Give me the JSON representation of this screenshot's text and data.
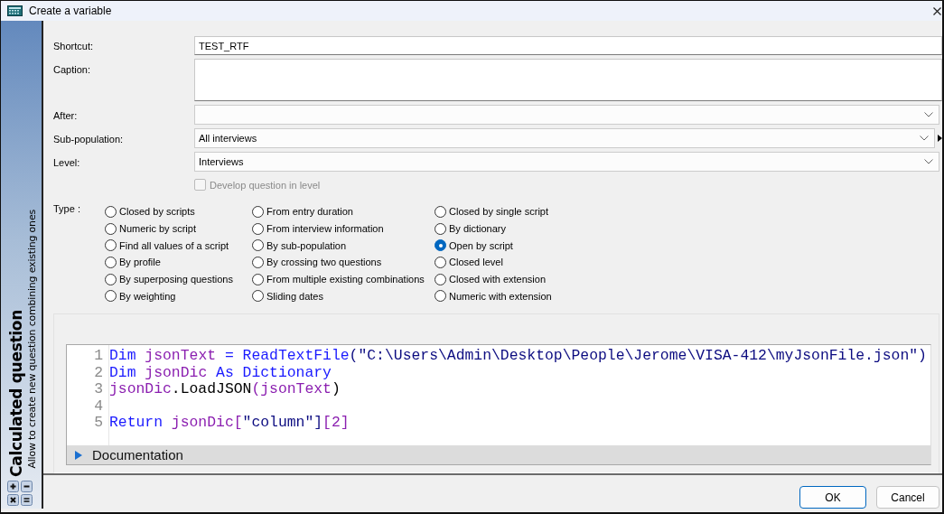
{
  "window": {
    "title": "Create a variable"
  },
  "sidebar": {
    "title": "Calculated question",
    "subtitle": "Allow to create new question combining existing ones"
  },
  "fields": [
    {
      "kind": "text",
      "label": "Shortcut:",
      "value": "TEST_RTF"
    },
    {
      "kind": "textarea",
      "label": "Caption:"
    },
    {
      "kind": "dropdown",
      "label": "After:",
      "side_arrow": false
    },
    {
      "kind": "dropdown",
      "label": "Sub-population:",
      "value": "All interviews",
      "side_arrow": true
    },
    {
      "kind": "dropdown",
      "label": "Level:",
      "value": "Interviews",
      "side_arrow": false
    }
  ],
  "develop_checkbox": {
    "label": "Develop question in level",
    "checked": false,
    "disabled": true
  },
  "type": {
    "label": "Type :",
    "columns": [
      [
        {
          "label": "Closed by scripts",
          "selected": false
        },
        {
          "label": "Numeric by script",
          "selected": false
        },
        {
          "label": "Find all values of a script",
          "selected": false
        },
        {
          "label": "By profile",
          "selected": false
        },
        {
          "label": "By superposing questions",
          "selected": false
        },
        {
          "label": "By weighting",
          "selected": false
        }
      ],
      [
        {
          "label": "From entry duration",
          "selected": false
        },
        {
          "label": "From interview information",
          "selected": false
        },
        {
          "label": "By sub-population",
          "selected": false
        },
        {
          "label": "By crossing two questions",
          "selected": false
        },
        {
          "label": "From multiple existing combinations",
          "selected": false
        },
        {
          "label": "Sliding dates",
          "selected": false
        }
      ],
      [
        {
          "label": "Closed by single script",
          "selected": false
        },
        {
          "label": "By dictionary",
          "selected": false
        },
        {
          "label": "Open by script",
          "selected": true
        },
        {
          "label": "Closed level",
          "selected": false
        },
        {
          "label": "Closed with extension",
          "selected": false
        },
        {
          "label": "Numeric with extension",
          "selected": false
        }
      ]
    ]
  },
  "editor": {
    "lines": [
      {
        "number": "1",
        "tokens": [
          {
            "kind": "keyword",
            "text": "Dim "
          },
          {
            "kind": "identifier",
            "text": "jsonText"
          },
          {
            "kind": "keyword",
            "text": " = ReadTextFile"
          },
          {
            "kind": "string",
            "text": "(\"C:\\Users\\Admin\\Desktop\\People\\Jerome\\VISA-412\\myJsonFile.json\")"
          }
        ]
      },
      {
        "number": "2",
        "tokens": [
          {
            "kind": "keyword",
            "text": "Dim "
          },
          {
            "kind": "identifier",
            "text": "jsonDic"
          },
          {
            "kind": "keyword",
            "text": " As Dictionary"
          }
        ]
      },
      {
        "number": "3",
        "tokens": [
          {
            "kind": "identifier",
            "text": "jsonDic"
          },
          {
            "kind": "plain",
            "text": ".LoadJSON"
          },
          {
            "kind": "identifier",
            "text": "(jsonText"
          },
          {
            "kind": "plain",
            "text": ")"
          }
        ]
      },
      {
        "number": "4"
      },
      {
        "number": "5",
        "tokens": [
          {
            "kind": "keyword",
            "text": "Return "
          },
          {
            "kind": "identifier",
            "text": "jsonDic["
          },
          {
            "kind": "string",
            "text": "\"column\"]"
          },
          {
            "kind": "identifier",
            "text": "[2]"
          }
        ]
      }
    ],
    "documentation": {
      "label": "Documentation",
      "expanded": false
    }
  },
  "buttons": [
    {
      "label": "OK",
      "default": true
    },
    {
      "label": "Cancel",
      "default": false
    }
  ]
}
